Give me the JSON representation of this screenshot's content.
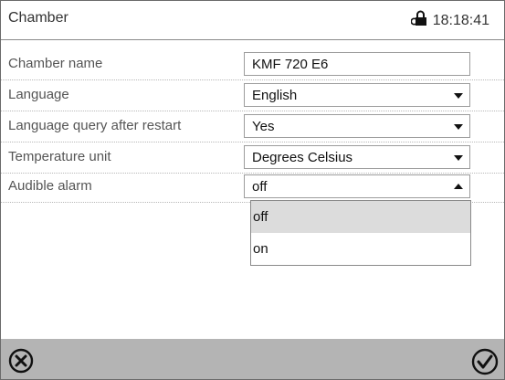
{
  "header": {
    "title": "Chamber",
    "time": "18:18:41",
    "status_icon": "door-lock-icon"
  },
  "settings": [
    {
      "label": "Chamber name",
      "value": "KMF 720 E6",
      "control": "text"
    },
    {
      "label": "Language",
      "value": "English",
      "control": "dropdown"
    },
    {
      "label": "Language query after restart",
      "value": "Yes",
      "control": "dropdown"
    },
    {
      "label": "Temperature unit",
      "value": "Degrees Celsius",
      "control": "dropdown"
    },
    {
      "label": "Audible alarm",
      "value": "off",
      "control": "dropdown-open"
    }
  ],
  "dropdown": {
    "options": [
      "off",
      "on"
    ],
    "selected": "off"
  },
  "footer": {
    "cancel_icon": "cancel-circle-x-icon",
    "confirm_icon": "confirm-circle-check-icon"
  },
  "colors": {
    "footer_bg": "#b4b4b4",
    "highlight": "#dcdcdc",
    "border": "#8a8a8a"
  }
}
